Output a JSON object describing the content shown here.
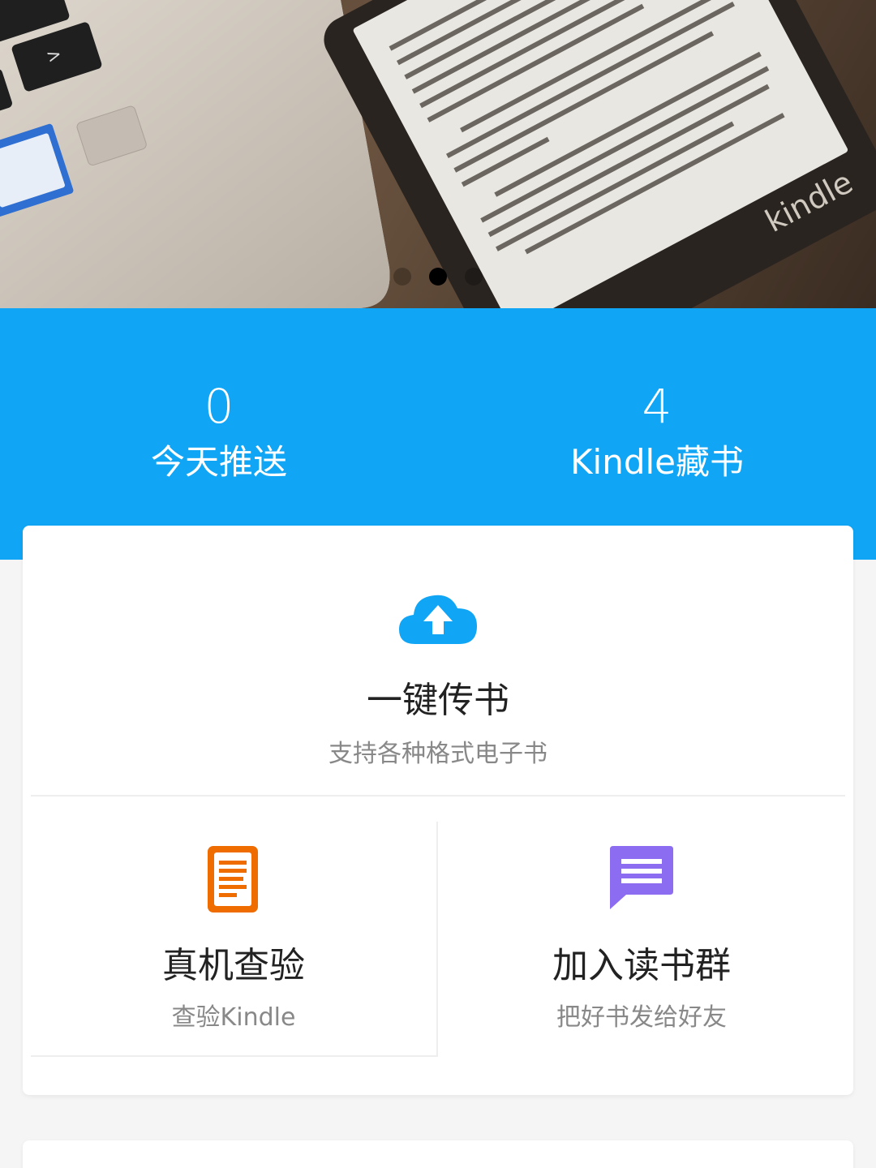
{
  "banner": {
    "slides": 3,
    "active_slide": 2,
    "brand_text": "kindle"
  },
  "stats": {
    "today_push": {
      "value": "0",
      "label": "今天推送"
    },
    "kindle_books": {
      "value": "4",
      "label": "Kindle藏书"
    }
  },
  "actions": {
    "upload": {
      "title": "一键传书",
      "subtitle": "支持各种格式电子书",
      "icon": "cloud-upload-icon"
    },
    "verify": {
      "title": "真机查验",
      "subtitle": "查验Kindle",
      "icon": "document-icon"
    },
    "group": {
      "title": "加入读书群",
      "subtitle": "把好书发给好友",
      "icon": "chat-icon"
    }
  },
  "colors": {
    "accent_blue": "#10a5f5",
    "doc_orange": "#ef6c00",
    "chat_purple": "#8c6cf0"
  }
}
